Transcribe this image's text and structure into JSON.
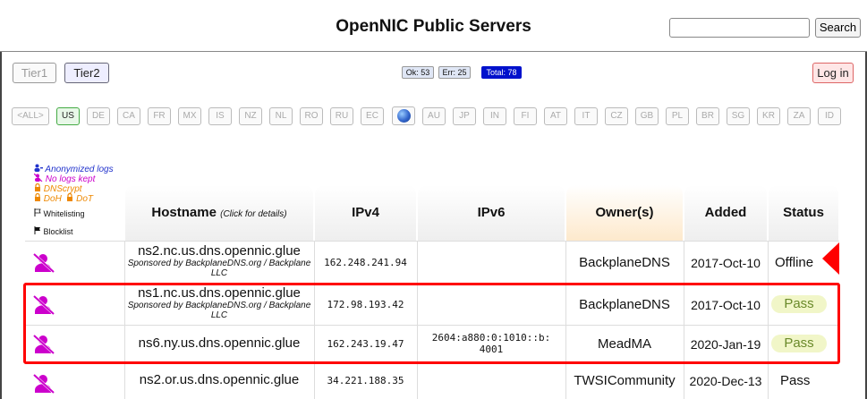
{
  "header": {
    "title": "OpenNIC Public Servers",
    "search_placeholder": "",
    "search_label": "Search"
  },
  "toolbar": {
    "tier1": "Tier1",
    "tier2": "Tier2",
    "ok": "Ok: 53",
    "err": "Err: 25",
    "total": "Total: 78",
    "login": "Log in"
  },
  "countries": [
    "<ALL>",
    "US",
    "DE",
    "CA",
    "FR",
    "MX",
    "IS",
    "NZ",
    "NL",
    "RO",
    "RU",
    "EC",
    "AU",
    "JP",
    "IN",
    "FI",
    "AT",
    "IT",
    "CZ",
    "GB",
    "PL",
    "BR",
    "SG",
    "KR",
    "ZA",
    "ID"
  ],
  "legend": {
    "anonymized": "Anonymized logs",
    "nologs": "No logs kept",
    "dnscrypt": "DNScrypt",
    "doh": "DoH",
    "dot": "DoT",
    "whitelisting": "Whitelisting",
    "blocklist": "Blocklist"
  },
  "table": {
    "headers": {
      "hostname": "Hostname",
      "hostname_hint": "(Click for details)",
      "ipv4": "IPv4",
      "ipv6": "IPv6",
      "owner": "Owner(s)",
      "added": "Added",
      "status": "Status"
    },
    "rows": [
      {
        "host": "ns2.nc.us.dns.opennic.glue",
        "sponsor": "Sponsored by BackplaneDNS.org / Backplane LLC",
        "ipv4": "162.248.241.94",
        "ipv6_l1": "",
        "ipv6_l2": "",
        "owner": "BackplaneDNS",
        "added": "2017-Oct-10",
        "status": "Offline"
      },
      {
        "host": "ns1.nc.us.dns.opennic.glue",
        "sponsor": "Sponsored by BackplaneDNS.org / Backplane LLC",
        "ipv4": "172.98.193.42",
        "ipv6_l1": "",
        "ipv6_l2": "",
        "owner": "BackplaneDNS",
        "added": "2017-Oct-10",
        "status": "Pass"
      },
      {
        "host": "ns6.ny.us.dns.opennic.glue",
        "sponsor": "",
        "ipv4": "162.243.19.47",
        "ipv6_l1": "2604:a880:0:1010::b:",
        "ipv6_l2": "4001",
        "owner": "MeadMA",
        "added": "2020-Jan-19",
        "status": "Pass"
      },
      {
        "host": "ns2.or.us.dns.opennic.glue",
        "sponsor": "",
        "ipv4": "34.221.188.35",
        "ipv6_l1": "",
        "ipv6_l2": "",
        "owner": "TWSICommunity",
        "added": "2020-Dec-13",
        "status": "Pass"
      }
    ]
  },
  "colors": {
    "highlight": "#ff0000",
    "no_logs_icon": "#cc00cc",
    "pass_bg": "#f1f6c8",
    "pass_text": "#6a8a2a"
  }
}
